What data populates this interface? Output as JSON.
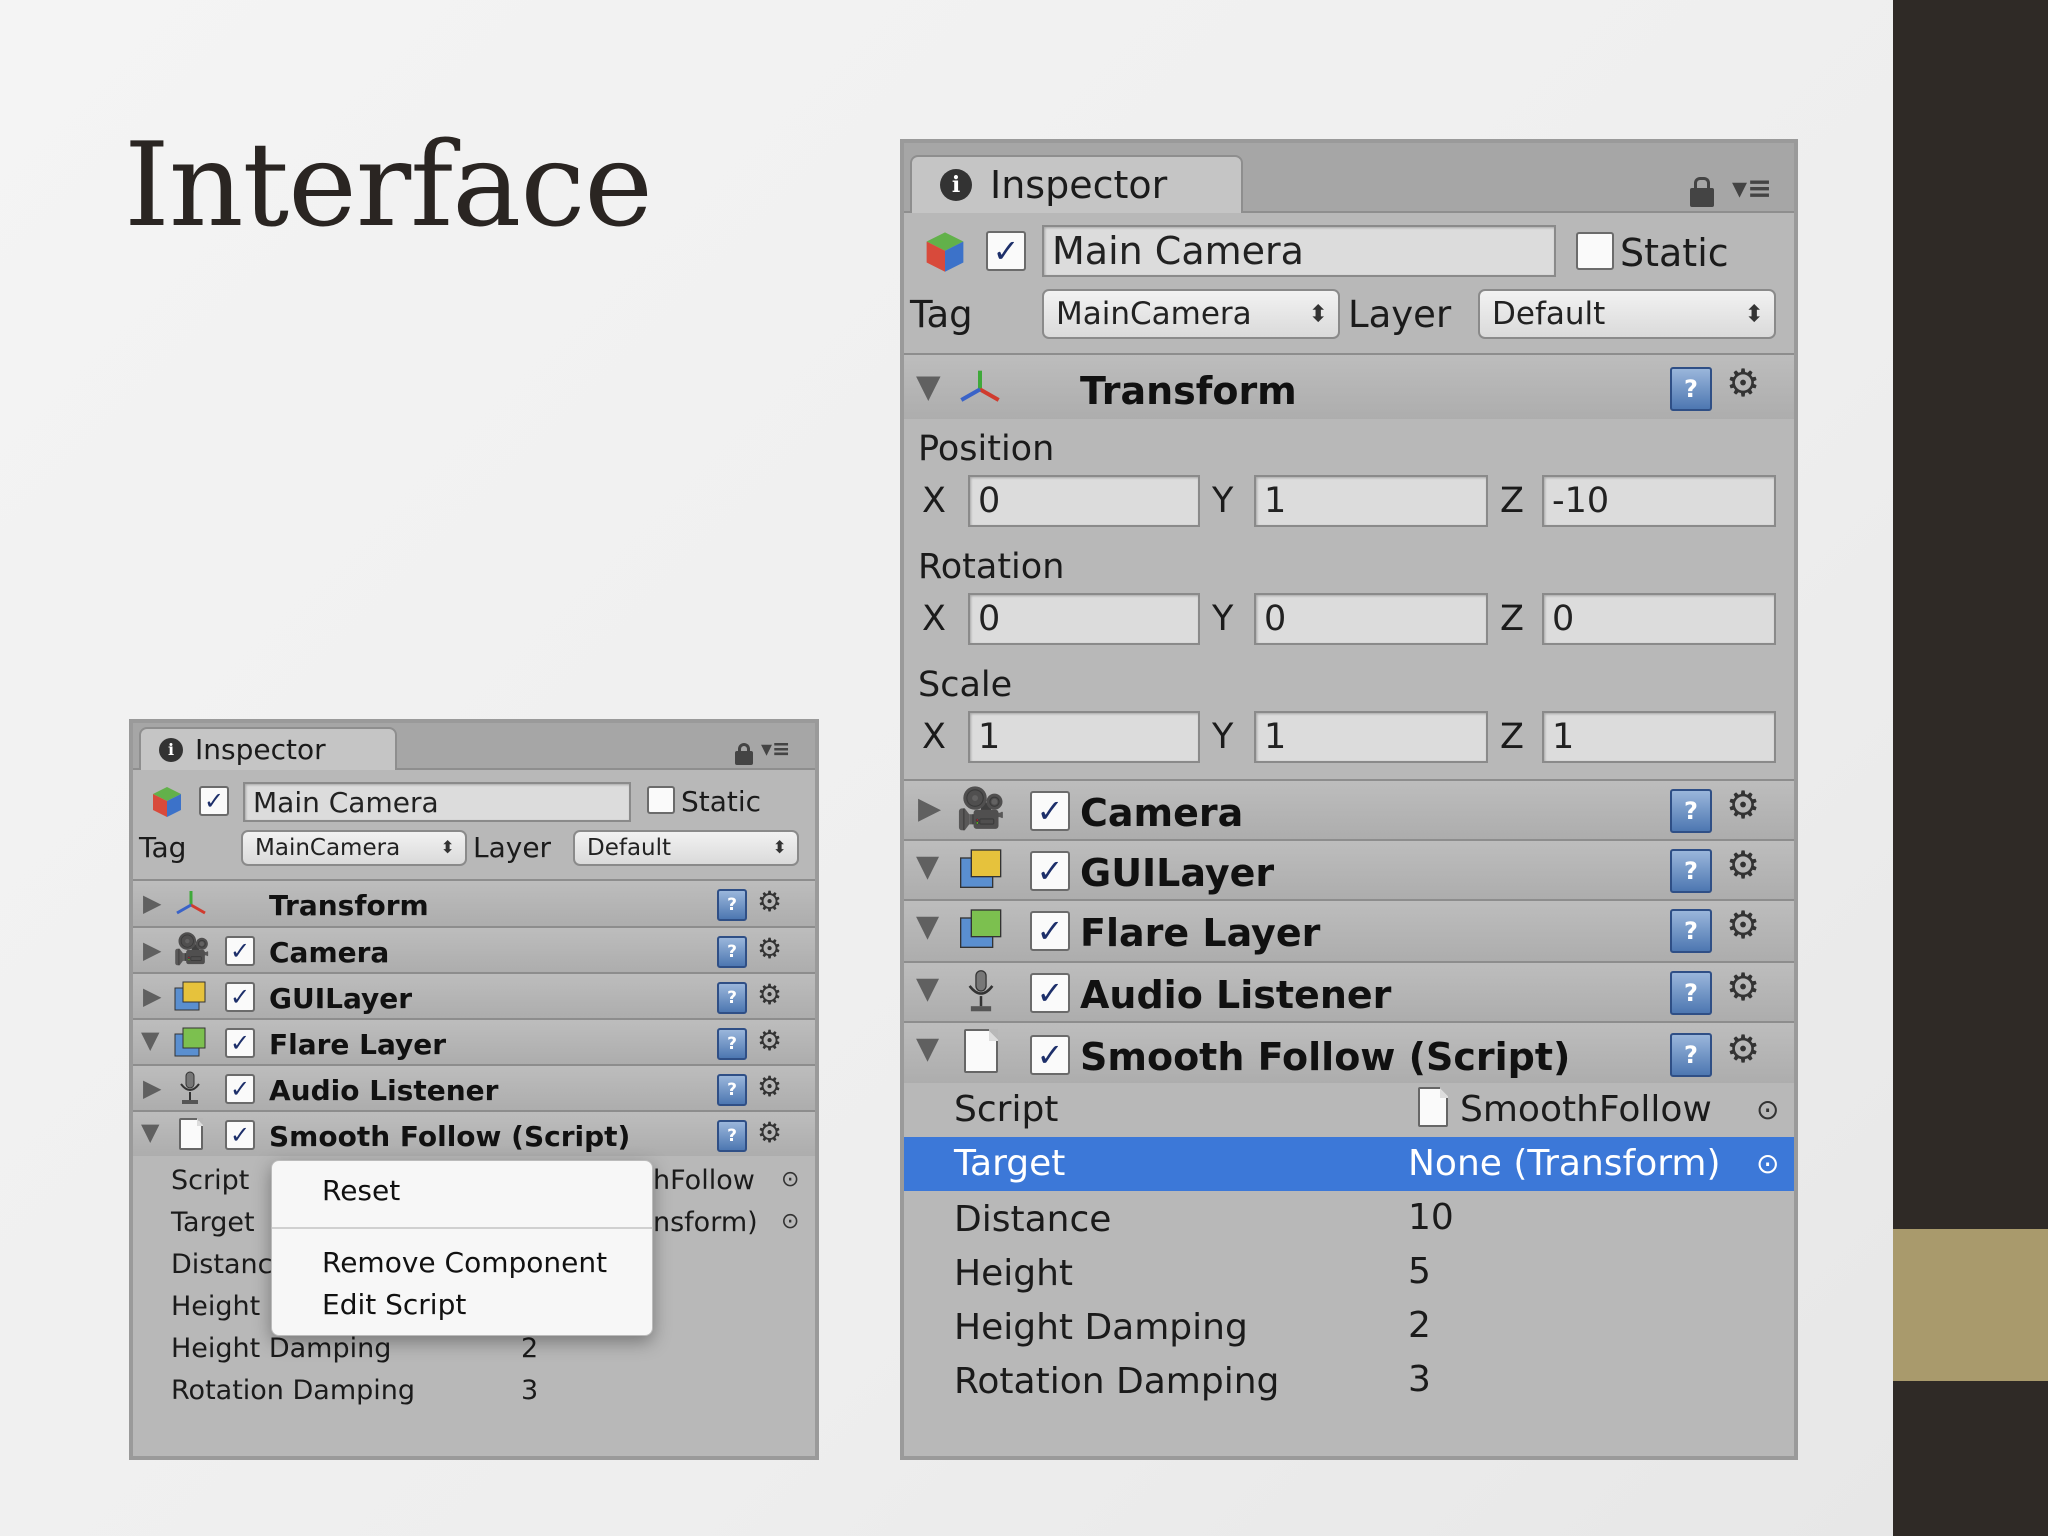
{
  "slide": {
    "title": "Interface",
    "colors": {
      "dark_bar": "#2f2a26",
      "accent_bar": "#a99a6c",
      "selection": "#3c78d8"
    }
  },
  "inspector_small": {
    "tab_label": "Inspector",
    "object_name": "Main Camera",
    "static_label": "Static",
    "tag_label": "Tag",
    "tag_value": "MainCamera",
    "layer_label": "Layer",
    "layer_value": "Default",
    "components": [
      {
        "name": "Transform",
        "icon": "transform-icon",
        "expanded": false
      },
      {
        "name": "Camera",
        "icon": "camera-icon",
        "expanded": false
      },
      {
        "name": "GUILayer",
        "icon": "guilayer-icon",
        "expanded": false
      },
      {
        "name": "Flare Layer",
        "icon": "flare-layer-icon",
        "expanded": true
      },
      {
        "name": "Audio Listener",
        "icon": "audio-listener-icon",
        "expanded": false
      },
      {
        "name": "Smooth Follow (Script)",
        "icon": "script-icon",
        "expanded": true
      }
    ],
    "properties": [
      {
        "label": "Script",
        "value": "hFollow"
      },
      {
        "label": "Target",
        "value": "nsform)"
      },
      {
        "label": "Distanc",
        "value": ""
      },
      {
        "label": "Height",
        "value": ""
      },
      {
        "label": "Height Damping",
        "value": "2"
      },
      {
        "label": "Rotation Damping",
        "value": "3"
      }
    ],
    "context_menu": {
      "items": [
        "Reset",
        "Remove Component",
        "Edit Script"
      ]
    }
  },
  "inspector_large": {
    "tab_label": "Inspector",
    "object_name": "Main Camera",
    "static_label": "Static",
    "tag_label": "Tag",
    "tag_value": "MainCamera",
    "layer_label": "Layer",
    "layer_value": "Default",
    "transform": {
      "name": "Transform",
      "position": {
        "label": "Position",
        "x": "0",
        "y": "1",
        "z": "-10"
      },
      "rotation": {
        "label": "Rotation",
        "x": "0",
        "y": "0",
        "z": "0"
      },
      "scale": {
        "label": "Scale",
        "x": "1",
        "y": "1",
        "z": "1"
      },
      "axis_labels": {
        "x": "X",
        "y": "Y",
        "z": "Z"
      }
    },
    "components": [
      {
        "name": "Camera",
        "icon": "camera-icon",
        "expanded": false
      },
      {
        "name": "GUILayer",
        "icon": "guilayer-icon",
        "expanded": true
      },
      {
        "name": "Flare Layer",
        "icon": "flare-layer-icon",
        "expanded": true
      },
      {
        "name": "Audio Listener",
        "icon": "audio-listener-icon",
        "expanded": true
      },
      {
        "name": "Smooth Follow (Script)",
        "icon": "script-icon",
        "expanded": true
      }
    ],
    "properties": [
      {
        "label": "Script",
        "value": "SmoothFollow"
      },
      {
        "label": "Target",
        "value": "None (Transform)",
        "selected": true
      },
      {
        "label": "Distance",
        "value": "10"
      },
      {
        "label": "Height",
        "value": "5"
      },
      {
        "label": "Height Damping",
        "value": "2"
      },
      {
        "label": "Rotation Damping",
        "value": "3"
      }
    ]
  }
}
